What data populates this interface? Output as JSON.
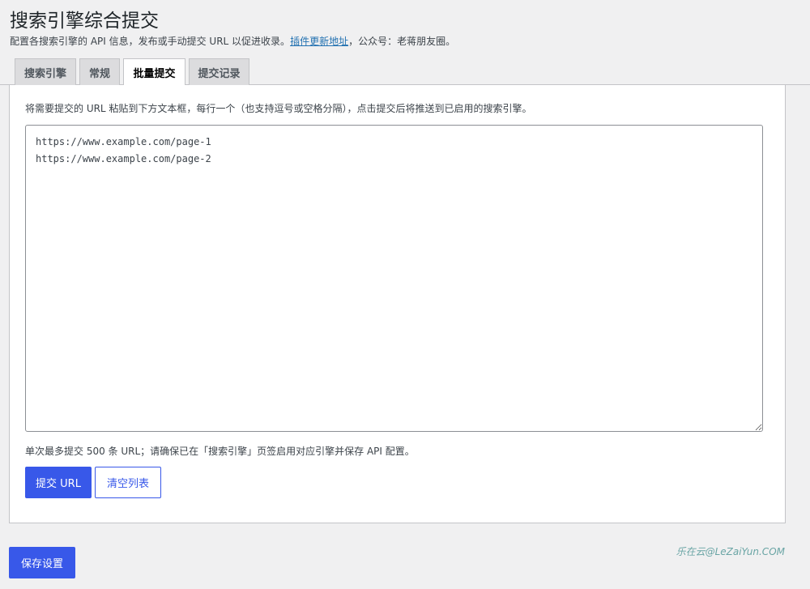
{
  "header": {
    "title": "搜索引擎综合提交",
    "subtitle_prefix": "配置各搜索引擎的 API 信息，发布或手动提交 URL 以促进收录。",
    "subtitle_link": "插件更新地址",
    "subtitle_suffix": "，公众号：老蒋朋友圈。"
  },
  "tabs": [
    {
      "label": "搜索引擎",
      "active": false
    },
    {
      "label": "常规",
      "active": false
    },
    {
      "label": "批量提交",
      "active": true
    },
    {
      "label": "提交记录",
      "active": false
    }
  ],
  "batch": {
    "description": "将需要提交的 URL 粘贴到下方文本框，每行一个（也支持逗号或空格分隔），点击提交后将推送到已启用的搜索引擎。",
    "textarea_value": "https://www.example.com/page-1\nhttps://www.example.com/page-2",
    "note": "单次最多提交 500 条 URL；请确保已在「搜索引擎」页签启用对应引擎并保存 API 配置。",
    "submit_label": "提交 URL",
    "clear_label": "清空列表"
  },
  "footer": {
    "save_label": "保存设置",
    "watermark": "乐在云@LeZaiYun.COM"
  },
  "colors": {
    "primary": "#3858e9",
    "link": "#2271b1",
    "background": "#f0f0f1"
  }
}
